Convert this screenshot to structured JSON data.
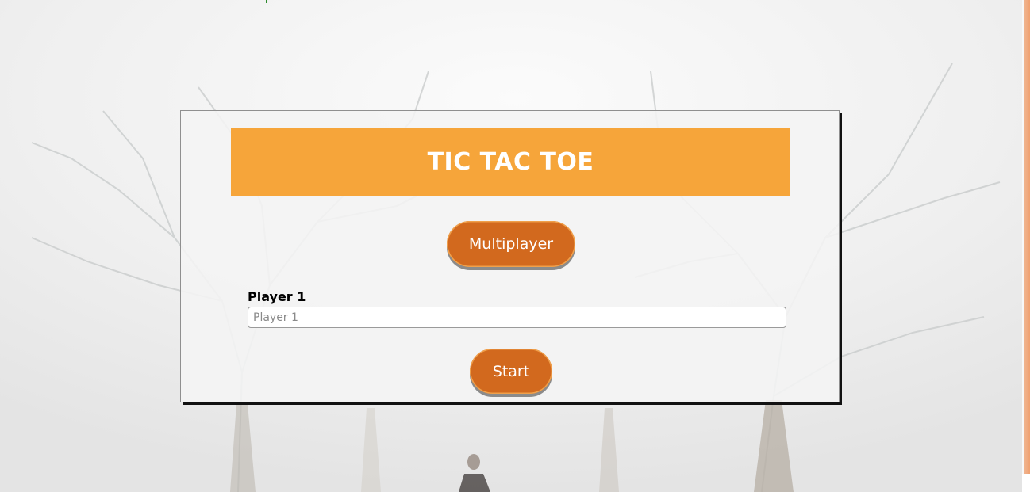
{
  "game": {
    "title": "TIC TAC TOE",
    "multiplayer_label": "Multiplayer",
    "player1_label": "Player 1",
    "player1_placeholder": "Player 1",
    "player1_value": "",
    "start_label": "Start"
  },
  "colors": {
    "banner": "#f6a53a",
    "button": "#d2691e",
    "card_bg": "#f4f4f4",
    "right_edge": "#f0a070"
  },
  "icons": {
    "background": "foggy-trees-background"
  }
}
